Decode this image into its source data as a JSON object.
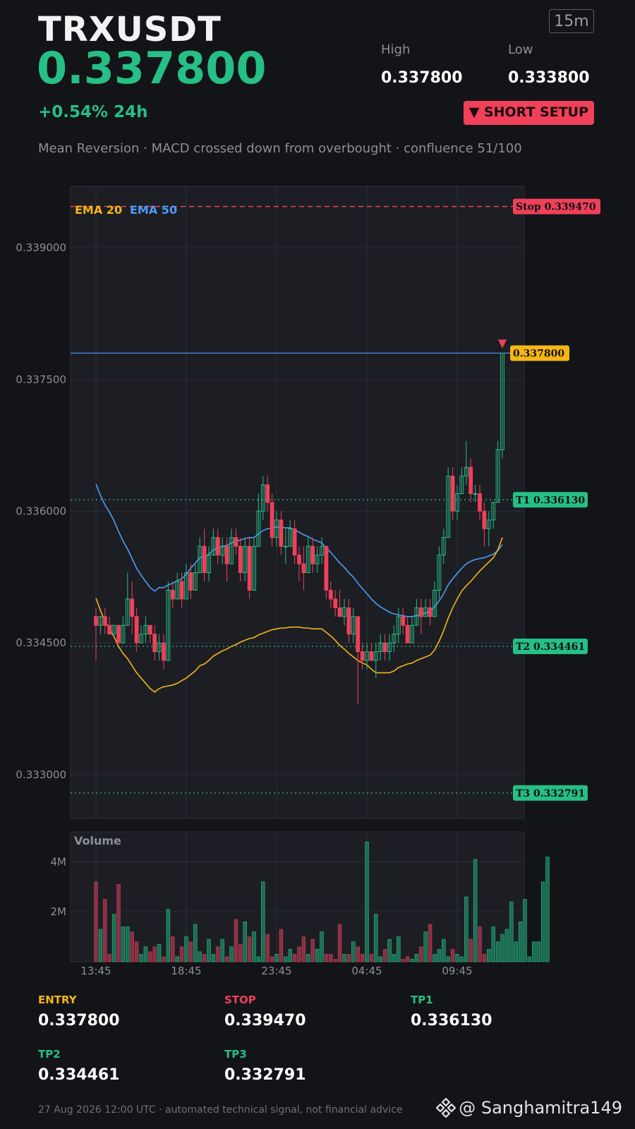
{
  "header": {
    "symbol": "TRXUSDT",
    "price": "0.337800",
    "timeframe": "15m",
    "high_label": "High",
    "high_value": "0.337800",
    "low_label": "Low",
    "low_value": "0.333800",
    "change": "+0.54%  24h",
    "setup_badge": "▼ SHORT SETUP",
    "description": "Mean Reversion · MACD crossed down from overbought · confluence 51/100"
  },
  "levels_panel": [
    {
      "label": "ENTRY",
      "value": "0.337800",
      "color": "#f5b616"
    },
    {
      "label": "STOP",
      "value": "0.339470",
      "color": "#f0405a"
    },
    {
      "label": "TP1",
      "value": "0.336130",
      "color": "#26bf86"
    },
    {
      "label": "TP2",
      "value": "0.334461",
      "color": "#26bf86"
    },
    {
      "label": "TP3",
      "value": "0.332791",
      "color": "#26bf86"
    }
  ],
  "footer": {
    "note": "27 Aug 2026 12:00 UTC  ·  automated technical signal, not financial advice",
    "brand": "@ Sanghamitra149"
  },
  "colors": {
    "up": "#26bf86",
    "down": "#f0405a",
    "ema20": "#f5b616",
    "ema50": "#4d9df5",
    "stop": "#f0405a",
    "target": "#26bf86",
    "last_price": "#f5b616",
    "background": "#131418",
    "panel": "#1c1e24"
  },
  "chart_data": [
    {
      "type": "candlestick",
      "title": "",
      "legend": [
        {
          "name": "EMA 20",
          "color": "#f5b616"
        },
        {
          "name": "EMA 50",
          "color": "#4d9df5"
        }
      ],
      "ylim": [
        0.3325,
        0.3397
      ],
      "yticks": [
        0.333,
        0.3345,
        0.336,
        0.3375,
        0.339
      ],
      "ytick_labels": [
        "0.333000",
        "0.334500",
        "0.336000",
        "0.337500",
        "0.339000"
      ],
      "xtick_labels": [
        "13:45",
        "18:45",
        "23:45",
        "04:45",
        "09:45"
      ],
      "xtick_index": [
        0,
        20,
        40,
        60,
        80
      ],
      "levels": [
        {
          "name": "Stop",
          "value": 0.33947,
          "label": "Stop 0.339470",
          "kind": "stop"
        },
        {
          "name": "T1",
          "value": 0.33613,
          "label": "T1 0.336130",
          "kind": "target"
        },
        {
          "name": "T2",
          "value": 0.334461,
          "label": "T2 0.334461",
          "kind": "target"
        },
        {
          "name": "T3",
          "value": 0.332791,
          "label": "T3 0.332791",
          "kind": "target"
        }
      ],
      "last_price": {
        "value": 0.3378,
        "label": "0.337800"
      },
      "signal_marker": "▼",
      "candles": [
        [
          0.3348,
          0.3349,
          0.3343,
          0.3347
        ],
        [
          0.3347,
          0.3348,
          0.3346,
          0.3348
        ],
        [
          0.3348,
          0.3349,
          0.3346,
          0.3347
        ],
        [
          0.3347,
          0.3348,
          0.3346,
          0.3346
        ],
        [
          0.3346,
          0.3347,
          0.3346,
          0.3347
        ],
        [
          0.3347,
          0.3347,
          0.3345,
          0.3345
        ],
        [
          0.3345,
          0.3348,
          0.3345,
          0.3347
        ],
        [
          0.3347,
          0.3353,
          0.3347,
          0.335
        ],
        [
          0.335,
          0.3352,
          0.3346,
          0.3348
        ],
        [
          0.3348,
          0.3349,
          0.3344,
          0.3345
        ],
        [
          0.3345,
          0.3347,
          0.3345,
          0.3346
        ],
        [
          0.3346,
          0.3348,
          0.3345,
          0.3347
        ],
        [
          0.3347,
          0.3347,
          0.3345,
          0.3346
        ],
        [
          0.3346,
          0.3347,
          0.3343,
          0.3344
        ],
        [
          0.3344,
          0.3346,
          0.3343,
          0.3345
        ],
        [
          0.3345,
          0.3346,
          0.3342,
          0.3343
        ],
        [
          0.3343,
          0.3352,
          0.3343,
          0.3351
        ],
        [
          0.3351,
          0.3352,
          0.3349,
          0.335
        ],
        [
          0.335,
          0.3353,
          0.335,
          0.3352
        ],
        [
          0.3352,
          0.3353,
          0.3349,
          0.335
        ],
        [
          0.335,
          0.3354,
          0.335,
          0.3353
        ],
        [
          0.3353,
          0.3354,
          0.335,
          0.3351
        ],
        [
          0.3351,
          0.3354,
          0.3351,
          0.3353
        ],
        [
          0.3353,
          0.3357,
          0.3353,
          0.3356
        ],
        [
          0.3356,
          0.3358,
          0.3352,
          0.3353
        ],
        [
          0.3353,
          0.3356,
          0.3352,
          0.3355
        ],
        [
          0.3355,
          0.3358,
          0.3355,
          0.3357
        ],
        [
          0.3357,
          0.3358,
          0.3354,
          0.3355
        ],
        [
          0.3355,
          0.3357,
          0.3354,
          0.3356
        ],
        [
          0.3356,
          0.3357,
          0.3352,
          0.3354
        ],
        [
          0.3354,
          0.3358,
          0.3354,
          0.3357
        ],
        [
          0.3357,
          0.3358,
          0.3355,
          0.3356
        ],
        [
          0.3356,
          0.3357,
          0.3352,
          0.3353
        ],
        [
          0.3353,
          0.3357,
          0.3352,
          0.3356
        ],
        [
          0.3356,
          0.3357,
          0.335,
          0.3351
        ],
        [
          0.3351,
          0.3357,
          0.3351,
          0.3356
        ],
        [
          0.3356,
          0.3362,
          0.3356,
          0.336
        ],
        [
          0.336,
          0.3364,
          0.3359,
          0.3363
        ],
        [
          0.3363,
          0.3364,
          0.336,
          0.3361
        ],
        [
          0.3361,
          0.3362,
          0.3356,
          0.3357
        ],
        [
          0.3357,
          0.336,
          0.3356,
          0.3359
        ],
        [
          0.3359,
          0.336,
          0.3355,
          0.3356
        ],
        [
          0.3356,
          0.3358,
          0.3354,
          0.3356
        ],
        [
          0.3356,
          0.3359,
          0.3356,
          0.3358
        ],
        [
          0.3358,
          0.3359,
          0.3354,
          0.3355
        ],
        [
          0.3355,
          0.3356,
          0.3352,
          0.3354
        ],
        [
          0.3354,
          0.3356,
          0.3351,
          0.3353
        ],
        [
          0.3353,
          0.3357,
          0.3353,
          0.3356
        ],
        [
          0.3356,
          0.3357,
          0.3353,
          0.3354
        ],
        [
          0.3354,
          0.3356,
          0.3353,
          0.3355
        ],
        [
          0.3355,
          0.3357,
          0.3354,
          0.3356
        ],
        [
          0.3356,
          0.3356,
          0.335,
          0.3351
        ],
        [
          0.3351,
          0.3352,
          0.3349,
          0.335
        ],
        [
          0.335,
          0.3351,
          0.3348,
          0.3349
        ],
        [
          0.3349,
          0.3351,
          0.3348,
          0.3348
        ],
        [
          0.3348,
          0.335,
          0.3347,
          0.3349
        ],
        [
          0.3349,
          0.335,
          0.3345,
          0.3346
        ],
        [
          0.3346,
          0.3349,
          0.3345,
          0.3348
        ],
        [
          0.3348,
          0.3348,
          0.3338,
          0.3344
        ],
        [
          0.3344,
          0.3345,
          0.3342,
          0.3343
        ],
        [
          0.3343,
          0.3345,
          0.3342,
          0.3344
        ],
        [
          0.3344,
          0.3345,
          0.3343,
          0.3343
        ],
        [
          0.3343,
          0.3345,
          0.3341,
          0.3344
        ],
        [
          0.3344,
          0.3346,
          0.3343,
          0.3345
        ],
        [
          0.3345,
          0.3346,
          0.3343,
          0.3344
        ],
        [
          0.3344,
          0.3346,
          0.3343,
          0.3345
        ],
        [
          0.3345,
          0.3347,
          0.3344,
          0.3346
        ],
        [
          0.3346,
          0.3349,
          0.3345,
          0.3348
        ],
        [
          0.3348,
          0.3349,
          0.3346,
          0.3347
        ],
        [
          0.3347,
          0.3348,
          0.3345,
          0.3345
        ],
        [
          0.3345,
          0.3348,
          0.3345,
          0.3347
        ],
        [
          0.3347,
          0.335,
          0.3347,
          0.3349
        ],
        [
          0.3349,
          0.335,
          0.3346,
          0.3348
        ],
        [
          0.3348,
          0.335,
          0.3348,
          0.3349
        ],
        [
          0.3349,
          0.335,
          0.3347,
          0.3348
        ],
        [
          0.3348,
          0.3352,
          0.3348,
          0.3351
        ],
        [
          0.3351,
          0.3356,
          0.335,
          0.3355
        ],
        [
          0.3355,
          0.3358,
          0.3354,
          0.3357
        ],
        [
          0.3357,
          0.3365,
          0.3357,
          0.3364
        ],
        [
          0.3364,
          0.3365,
          0.3359,
          0.336
        ],
        [
          0.336,
          0.3363,
          0.3359,
          0.3362
        ],
        [
          0.3362,
          0.3365,
          0.3362,
          0.3364
        ],
        [
          0.3364,
          0.3368,
          0.3363,
          0.3365
        ],
        [
          0.3365,
          0.3366,
          0.3361,
          0.3362
        ],
        [
          0.3362,
          0.3363,
          0.3361,
          0.3362
        ],
        [
          0.3362,
          0.3363,
          0.3359,
          0.336
        ],
        [
          0.336,
          0.3361,
          0.3356,
          0.3358
        ],
        [
          0.3358,
          0.336,
          0.3356,
          0.3359
        ],
        [
          0.3359,
          0.3361,
          0.3358,
          0.3361
        ],
        [
          0.3361,
          0.3368,
          0.3361,
          0.3367
        ],
        [
          0.3367,
          0.3378,
          0.3366,
          0.3378
        ]
      ],
      "ema20": [
        0.33501,
        0.33487,
        0.33474,
        0.33466,
        0.33457,
        0.33446,
        0.33438,
        0.33432,
        0.33424,
        0.33416,
        0.3341,
        0.33404,
        0.33398,
        0.33394,
        0.33398,
        0.334,
        0.33401,
        0.33402,
        0.33404,
        0.33407,
        0.3341,
        0.33414,
        0.33418,
        0.33424,
        0.33426,
        0.3343,
        0.33435,
        0.33438,
        0.33441,
        0.33443,
        0.33446,
        0.33448,
        0.33451,
        0.33453,
        0.33455,
        0.33456,
        0.33459,
        0.33461,
        0.33463,
        0.33465,
        0.33466,
        0.33467,
        0.33467,
        0.33468,
        0.33468,
        0.33468,
        0.33467,
        0.33467,
        0.33466,
        0.33466,
        0.33466,
        0.33462,
        0.33458,
        0.33453,
        0.33447,
        0.33443,
        0.33438,
        0.33434,
        0.3343,
        0.33427,
        0.33425,
        0.3342,
        0.33416,
        0.33416,
        0.33416,
        0.33416,
        0.33418,
        0.33422,
        0.33424,
        0.33426,
        0.33427,
        0.3343,
        0.33432,
        0.33434,
        0.33436,
        0.33442,
        0.33452,
        0.33464,
        0.33478,
        0.3349,
        0.335,
        0.33509,
        0.33515,
        0.3352,
        0.33526,
        0.33532,
        0.33537,
        0.33542,
        0.33547,
        0.33556,
        0.3357
      ],
      "ema50": [
        0.33631,
        0.33618,
        0.33607,
        0.33599,
        0.33589,
        0.33577,
        0.33566,
        0.33557,
        0.33546,
        0.33535,
        0.33527,
        0.3352,
        0.33513,
        0.33509,
        0.33513,
        0.33513,
        0.33516,
        0.33518,
        0.33521,
        0.33523,
        0.33528,
        0.33535,
        0.33541,
        0.33547,
        0.33548,
        0.33551,
        0.33556,
        0.33558,
        0.3356,
        0.33561,
        0.33564,
        0.33566,
        0.33567,
        0.33569,
        0.3357,
        0.3357,
        0.33574,
        0.33578,
        0.3358,
        0.33581,
        0.33582,
        0.33582,
        0.33581,
        0.33581,
        0.33579,
        0.33576,
        0.33573,
        0.33571,
        0.33568,
        0.33566,
        0.33564,
        0.33558,
        0.33553,
        0.33547,
        0.33541,
        0.33536,
        0.3353,
        0.33525,
        0.33518,
        0.33512,
        0.33506,
        0.335,
        0.33495,
        0.33491,
        0.33488,
        0.33485,
        0.33483,
        0.33482,
        0.33481,
        0.3348,
        0.3348,
        0.33481,
        0.33482,
        0.33484,
        0.33486,
        0.33491,
        0.33498,
        0.33506,
        0.33516,
        0.33523,
        0.33529,
        0.33535,
        0.3354,
        0.33543,
        0.33545,
        0.33546,
        0.33547,
        0.33549,
        0.33551,
        0.33555,
        0.33562
      ]
    },
    {
      "type": "bar",
      "title": "Volume",
      "ylim": [
        0,
        5200000
      ],
      "yticks": [
        2000000,
        4000000
      ],
      "ytick_labels": [
        "2M",
        "4M"
      ],
      "values": [
        3200000,
        1300000,
        2500000,
        300000,
        1900000,
        3100000,
        1400000,
        1400000,
        1200000,
        800000,
        300000,
        600000,
        400000,
        600000,
        700000,
        200000,
        2100000,
        1000000,
        200000,
        600000,
        1000000,
        800000,
        1500000,
        400000,
        300000,
        900000,
        300000,
        600000,
        900000,
        200000,
        600000,
        1700000,
        700000,
        1600000,
        1000000,
        1200000,
        200000,
        3200000,
        1100000,
        200000,
        300000,
        1300000,
        200000,
        500000,
        300000,
        600000,
        1000000,
        300000,
        900000,
        500000,
        1200000,
        300000,
        300000,
        100000,
        1500000,
        300000,
        300000,
        800000,
        600000,
        300000,
        4800000,
        300000,
        1900000,
        200000,
        500000,
        900000,
        300000,
        1000000,
        100000,
        200000,
        100000,
        300000,
        600000,
        1200000,
        1500000,
        300000,
        500000,
        900000,
        200000,
        500000,
        300000,
        200000,
        2600000,
        900000,
        4100000,
        1400000,
        300000,
        500000,
        1400000,
        800000,
        1100000,
        1300000,
        2400000,
        800000,
        1600000,
        2500000,
        200000,
        800000,
        800000,
        3200000,
        4200000
      ],
      "colors_up_down": "matches candles"
    }
  ]
}
